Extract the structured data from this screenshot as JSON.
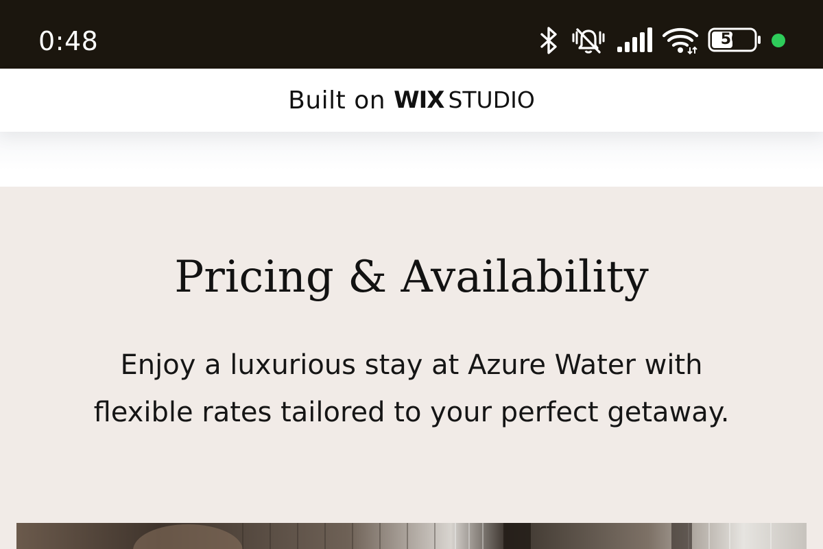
{
  "status_bar": {
    "time": "0:48",
    "icons": [
      "bluetooth-icon",
      "mute-icon",
      "signal-icon",
      "wifi-icon",
      "battery-icon",
      "dot-icon"
    ],
    "battery_level": "50",
    "dot_color": "#2ecc5a",
    "background": "#1b160e"
  },
  "wix_banner": {
    "built_on": "Built on",
    "logo_wix": "WIX",
    "logo_studio": "STUDIO"
  },
  "pricing": {
    "title": "Pricing & Availability",
    "description": "Enjoy a luxurious stay at Azure Water with flexible rates tailored to your perfect getaway.",
    "background": "#f1ebe7"
  },
  "hero_image": {
    "icon": "room-photo"
  }
}
